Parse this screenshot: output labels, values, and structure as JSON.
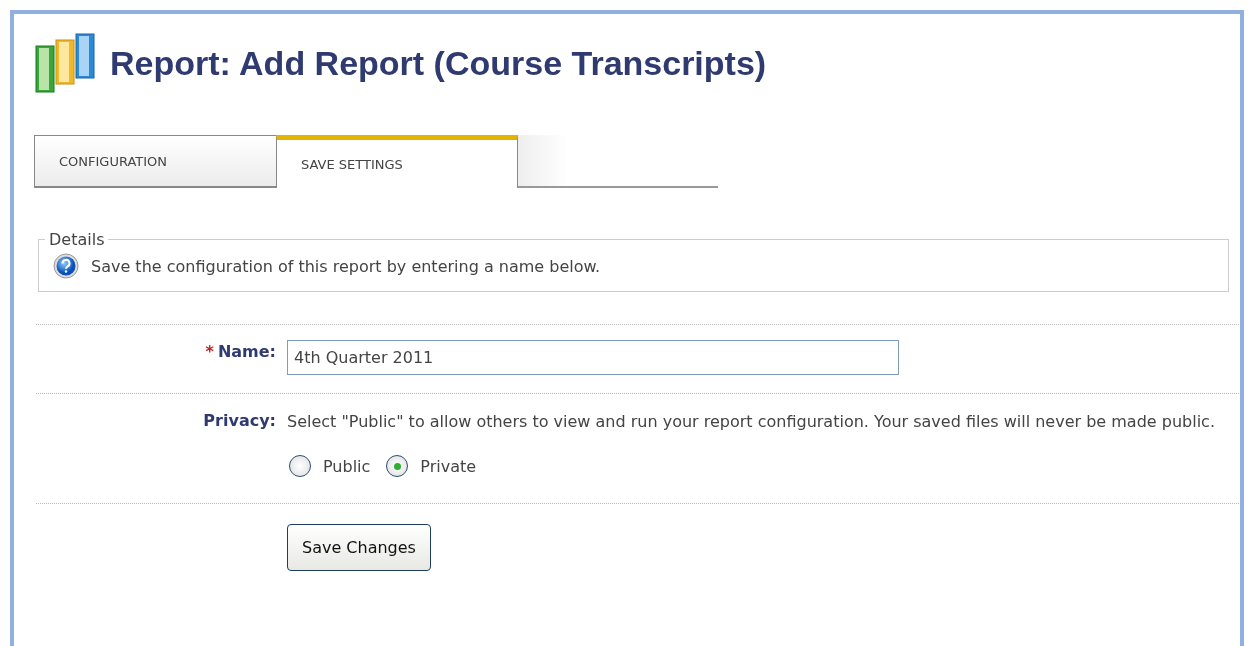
{
  "title": "Report: Add Report (Course Transcripts)",
  "tabs": [
    {
      "label": "CONFIGURATION",
      "selected": false
    },
    {
      "label": "SAVE SETTINGS",
      "selected": true
    }
  ],
  "details": {
    "legend": "Details",
    "message": "Save the configuration of this report by entering a name below."
  },
  "name_field": {
    "required_mark": "*",
    "label": "Name:",
    "value": "4th Quarter 2011"
  },
  "privacy": {
    "label": "Privacy:",
    "description": "Select \"Public\" to allow others to view and run your report configuration. Your saved files will never be made public.",
    "options": [
      {
        "label": "Public",
        "selected": false
      },
      {
        "label": "Private",
        "selected": true
      }
    ]
  },
  "buttons": [
    "Save Changes"
  ]
}
